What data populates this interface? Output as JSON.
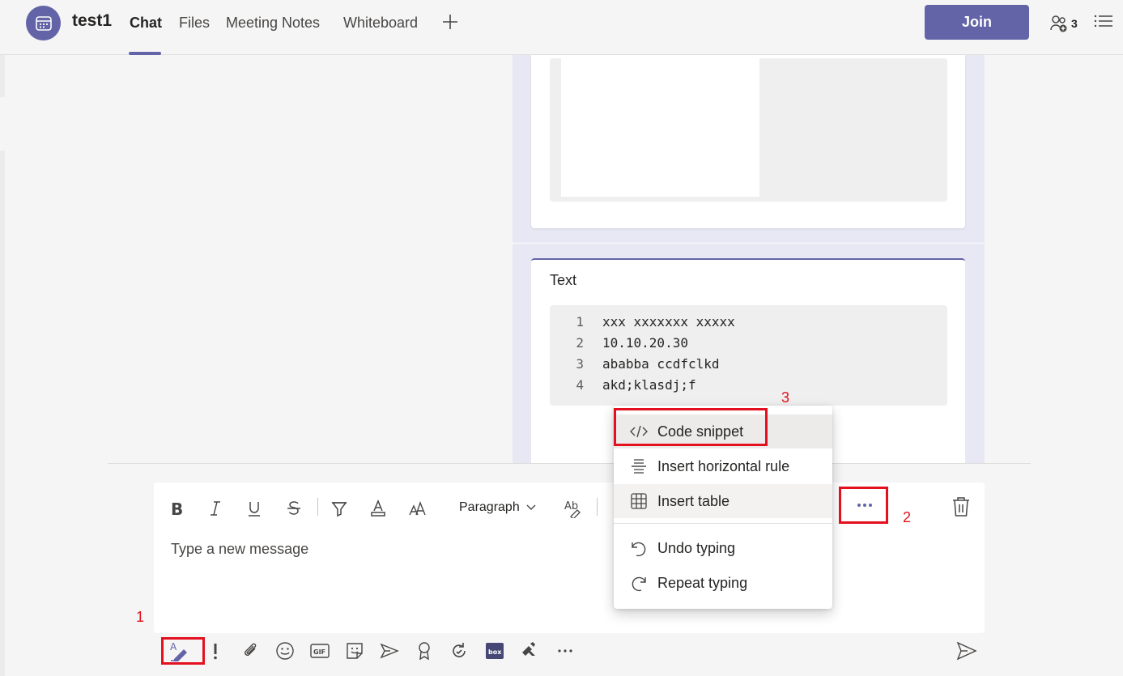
{
  "header": {
    "title": "test1",
    "tabs": [
      {
        "label": "Chat",
        "active": true
      },
      {
        "label": "Files",
        "active": false
      },
      {
        "label": "Meeting Notes",
        "active": false
      },
      {
        "label": "Whiteboard",
        "active": false
      }
    ],
    "join_label": "Join",
    "participant_count": "3",
    "accent_color": "#6264a7"
  },
  "message": {
    "card_label": "Text",
    "code_lines": [
      {
        "num": "1",
        "text": "xxx xxxxxxx xxxxx"
      },
      {
        "num": "2",
        "text": "10.10.20.30"
      },
      {
        "num": "3",
        "text": "ababba ccdfclkd"
      },
      {
        "num": "4",
        "text": "akd;klasdj;f"
      }
    ]
  },
  "compose": {
    "placeholder": "Type a new message",
    "paragraph_label": "Paragraph",
    "format_icons": [
      "bold-icon",
      "italic-icon",
      "underline-icon",
      "strikethrough-icon",
      "highlight-icon",
      "font-color-icon",
      "font-size-icon",
      "spellcheck-icon"
    ],
    "toolbar_icons": [
      "format-icon",
      "important-icon",
      "attach-icon",
      "emoji-icon",
      "gif-icon",
      "sticker-icon",
      "meet-now-icon",
      "praise-icon",
      "loop-icon",
      "box-icon",
      "apps-icon",
      "more-icon"
    ]
  },
  "menu": {
    "items": [
      {
        "label": "Code snippet",
        "icon": "code-icon"
      },
      {
        "label": "Insert horizontal rule",
        "icon": "horizontal-rule-icon"
      },
      {
        "label": "Insert table",
        "icon": "table-icon"
      },
      {
        "label": "Undo typing",
        "icon": "undo-icon"
      },
      {
        "label": "Repeat typing",
        "icon": "redo-icon"
      }
    ]
  },
  "annotations": {
    "num1": "1",
    "num2": "2",
    "num3": "3",
    "color": "#e3101f"
  }
}
